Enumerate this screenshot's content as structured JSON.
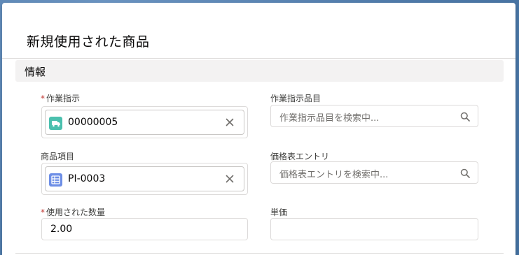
{
  "modal": {
    "title": "新規使用された商品",
    "section_title": "情報"
  },
  "fields": {
    "work_order": {
      "label": "作業指示",
      "required": "*",
      "value": "00000005",
      "icon": "van-icon",
      "icon_color": "#4bc0ae"
    },
    "work_order_line_item": {
      "label": "作業指示品目",
      "placeholder": "作業指示品目を検索中..."
    },
    "product_item": {
      "label": "商品項目",
      "value": "PI-0003",
      "icon": "table-icon",
      "icon_color": "#6e8fe6"
    },
    "price_book_entry": {
      "label": "価格表エントリ",
      "placeholder": "価格表エントリを検索中..."
    },
    "quantity_consumed": {
      "label": "使用された数量",
      "required": "*",
      "value": "2.00"
    },
    "unit_price": {
      "label": "単価",
      "value": ""
    }
  },
  "colors": {
    "required": "#c23934",
    "border": "#dddbda",
    "section_bg": "#f3f2f2"
  }
}
